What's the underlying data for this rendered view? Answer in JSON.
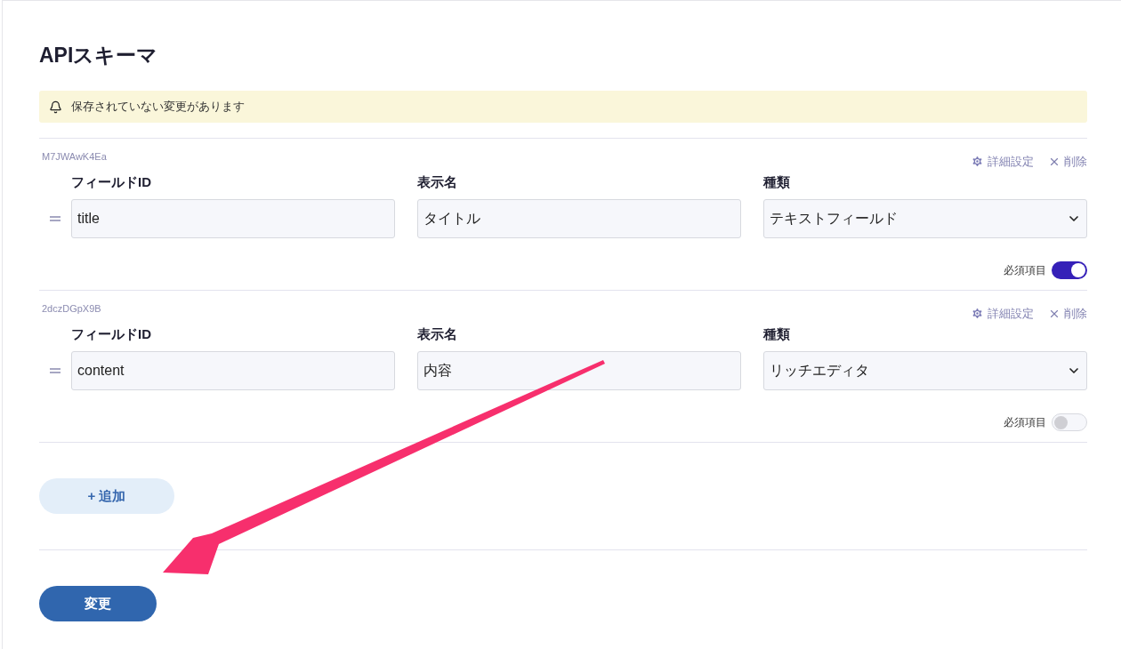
{
  "title": "APIスキーマ",
  "notice": {
    "text": "保存されていない変更があります"
  },
  "fields": [
    {
      "key": "M7JWAwK4Ea",
      "settings_label": "詳細設定",
      "delete_label": "削除",
      "id_label": "フィールドID",
      "id_value": "title",
      "name_label": "表示名",
      "name_value": "タイトル",
      "type_label": "種類",
      "type_value": "テキストフィールド",
      "required_label": "必須項目",
      "required": true
    },
    {
      "key": "2dczDGpX9B",
      "settings_label": "詳細設定",
      "delete_label": "削除",
      "id_label": "フィールドID",
      "id_value": "content",
      "name_label": "表示名",
      "name_value": "内容",
      "type_label": "種類",
      "type_value": "リッチエディタ",
      "required_label": "必須項目",
      "required": false
    }
  ],
  "add_button": "+ 追加",
  "submit_button": "変更"
}
